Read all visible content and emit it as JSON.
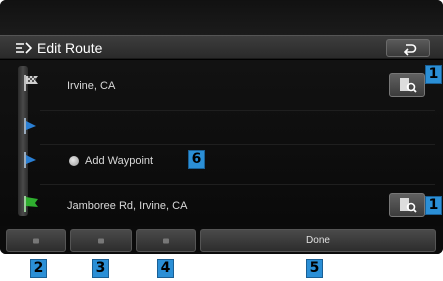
{
  "header": {
    "title": "Edit Route"
  },
  "route": {
    "start": {
      "label": "Irvine, CA"
    },
    "waypoint": {
      "label": "Add Waypoint"
    },
    "destination": {
      "label": "Jamboree Rd, Irvine, CA"
    }
  },
  "bottom_bar": {
    "done_label": "Done"
  },
  "callouts": [
    "1",
    "1",
    "2",
    "3",
    "4",
    "5",
    "6"
  ],
  "colors": {
    "callout_bg": "#2b8fd6",
    "flag_blue": "#2a7fd4",
    "flag_green": "#2fae2f"
  },
  "icons": {
    "title": "edit-route-icon",
    "back": "back-arrow-icon",
    "search": "map-search-icon",
    "waypoint": "waypoint-dot-icon"
  }
}
